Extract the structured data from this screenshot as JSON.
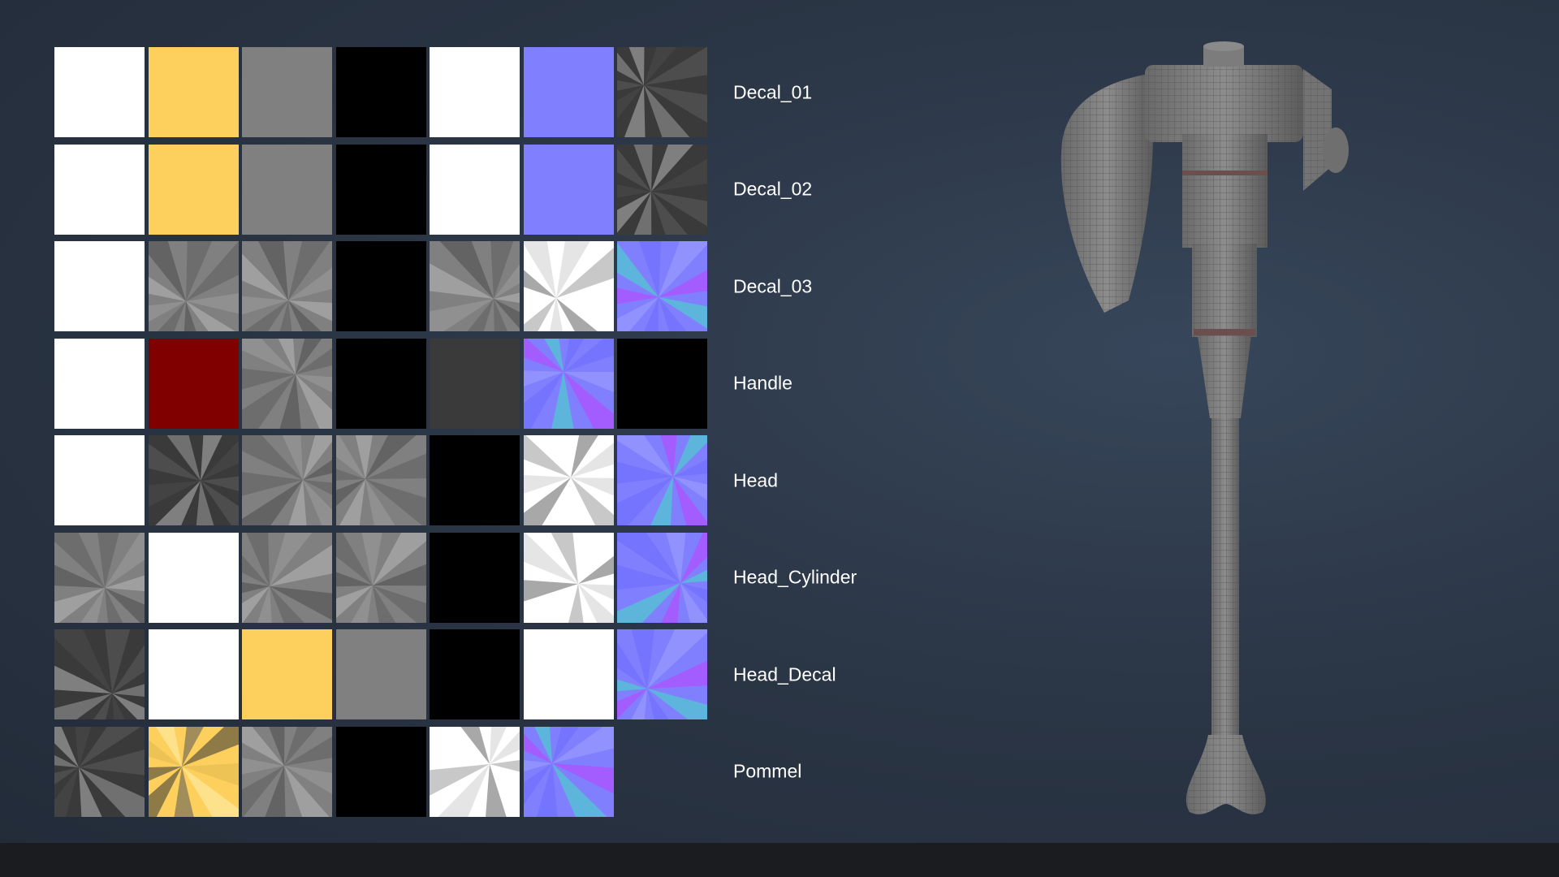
{
  "colors": {
    "white": "#ffffff",
    "yellow": "#fdd05e",
    "gray": "#808080",
    "black": "#000000",
    "normal": "#8080ff",
    "dark": "#3a3a3a",
    "red": "#800000"
  },
  "rows": [
    {
      "label": "Decal_01",
      "tiles": [
        "white",
        "yellow",
        "gray",
        "black",
        "white",
        "normal",
        "dark-pattern"
      ]
    },
    {
      "label": "Decal_02",
      "tiles": [
        "white",
        "yellow",
        "gray",
        "black",
        "white",
        "normal",
        "dark-pattern"
      ]
    },
    {
      "label": "Decal_03",
      "tiles": [
        "white",
        "gray-pattern",
        "gray-pattern",
        "black",
        "gray-pattern",
        "white-pattern",
        "normal-pattern"
      ]
    },
    {
      "label": "Handle",
      "tiles": [
        "white",
        "red",
        "gray-pattern",
        "black",
        "dark",
        "normal-pattern",
        "black"
      ]
    },
    {
      "label": "Head",
      "tiles": [
        "white",
        "dark-pattern",
        "gray-pattern",
        "gray-pattern",
        "black",
        "white-pattern",
        "normal-pattern"
      ]
    },
    {
      "label": "Head_Cylinder",
      "tiles": [
        "gray-pattern",
        "white",
        "gray-pattern",
        "gray-pattern",
        "black",
        "white-pattern",
        "normal-pattern"
      ]
    },
    {
      "label": "Head_Decal",
      "tiles": [
        "dark-pattern",
        "white",
        "yellow",
        "gray",
        "black",
        "white",
        "normal-pattern"
      ]
    },
    {
      "label": "Pommel",
      "tiles": [
        "dark-pattern",
        "yellow-pattern",
        "gray-pattern",
        "black",
        "white-pattern",
        "normal-pattern"
      ]
    }
  ],
  "model": {
    "icon": "hammer-wireframe-icon"
  }
}
